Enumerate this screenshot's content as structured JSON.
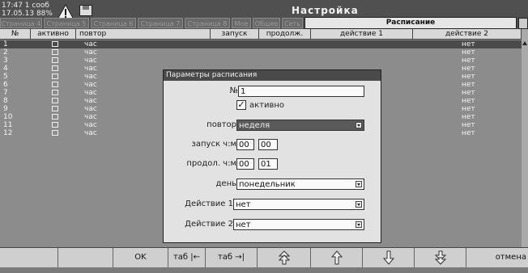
{
  "header": {
    "info_line1": "17:47 1 сооб",
    "info_line2": "17.05.13 88%",
    "title": "Настройка"
  },
  "tabs": [
    {
      "label": "Страница 4"
    },
    {
      "label": "Страница 5"
    },
    {
      "label": "Страница 6"
    },
    {
      "label": "Страница 7"
    },
    {
      "label": "Страница 8"
    },
    {
      "label": "Мое"
    },
    {
      "label": "Общее"
    },
    {
      "label": "Сеть"
    },
    {
      "label": "Расписание"
    }
  ],
  "active_tab": "Расписание",
  "columns": [
    "№",
    "активно",
    "повтор",
    "запуск",
    "продолж.",
    "действие 1",
    "действие 2"
  ],
  "rows": [
    {
      "n": "1",
      "repeat": "час",
      "action2": "нет"
    },
    {
      "n": "2",
      "repeat": "час",
      "action2": "нет"
    },
    {
      "n": "3",
      "repeat": "час",
      "action2": "нет"
    },
    {
      "n": "4",
      "repeat": "час",
      "action2": "нет"
    },
    {
      "n": "5",
      "repeat": "час",
      "action2": "нет"
    },
    {
      "n": "6",
      "repeat": "час",
      "action2": "нет"
    },
    {
      "n": "7",
      "repeat": "час",
      "action2": "нет"
    },
    {
      "n": "8",
      "repeat": "час",
      "action2": "нет"
    },
    {
      "n": "9",
      "repeat": "час",
      "action2": "нет"
    },
    {
      "n": "10",
      "repeat": "час",
      "action2": "нет"
    },
    {
      "n": "11",
      "repeat": "час",
      "action2": "нет"
    },
    {
      "n": "12",
      "repeat": "час",
      "action2": "нет"
    }
  ],
  "dialog": {
    "title": "Параметры расписания",
    "number_label": "№",
    "number_value": "1",
    "active_label": "активно",
    "active_checked": true,
    "active_mark": "✓",
    "repeat_label": "повтор",
    "repeat_value": "неделя",
    "start_label": "запуск ч:м",
    "start_h": "00",
    "start_m": "00",
    "duration_label": "продол. ч:м",
    "duration_h": "00",
    "duration_m": "01",
    "day_label": "день",
    "day_value": "понедельник",
    "action1_label": "Действие 1",
    "action1_value": "нет",
    "action2_label": "Действие 2",
    "action2_value": "нет"
  },
  "bottom": {
    "ok": "OK",
    "tab_back": "таб |←",
    "tab_fwd": "таб →|",
    "cancel": "отмена"
  },
  "icons": {
    "warning": "warning-icon",
    "disk": "disk-icon",
    "arrows": [
      "double-arrow-up-icon",
      "arrow-up-icon",
      "arrow-down-icon",
      "double-arrow-down-icon"
    ]
  }
}
